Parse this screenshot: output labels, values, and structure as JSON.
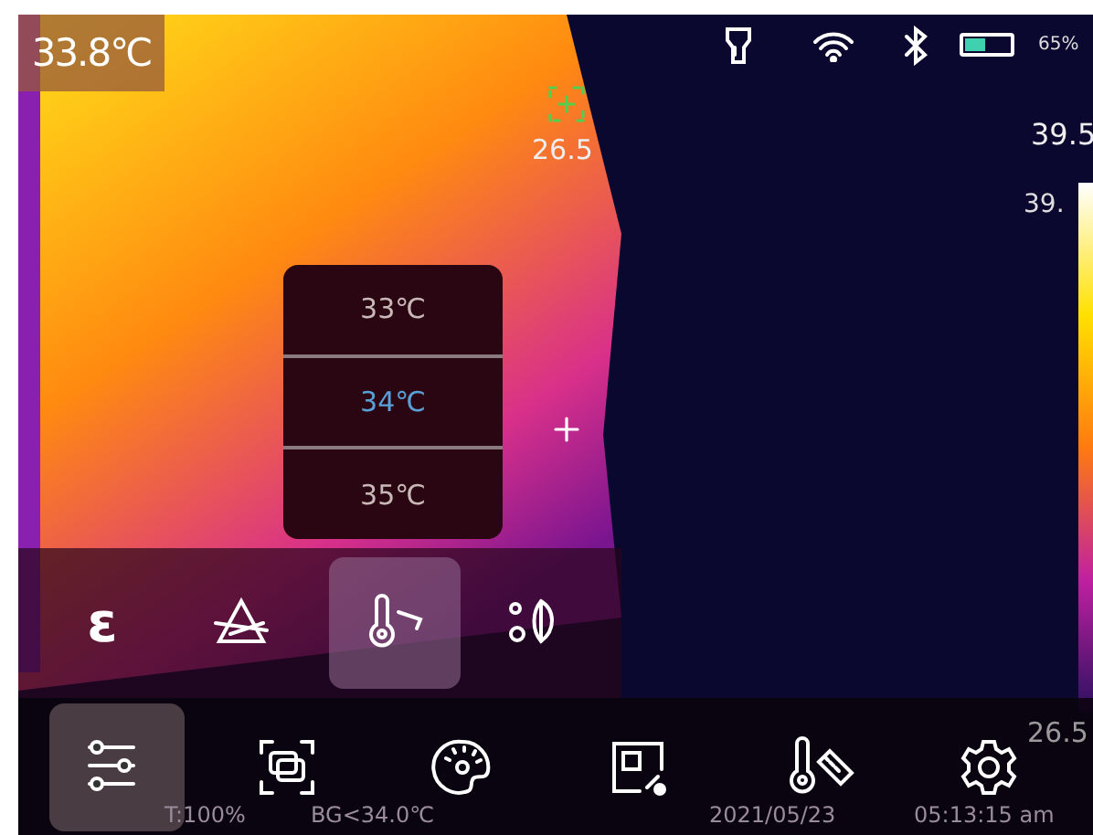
{
  "screen": {
    "spot_temperature": "33.8℃",
    "target_reading": "26.5",
    "status_bar": {
      "battery_percent": "65%"
    },
    "color_scale": {
      "max_label": "39.5",
      "value_label": "39.",
      "min_label": "26.5"
    },
    "temperature_picker": [
      {
        "label": "33℃",
        "selected": false
      },
      {
        "label": "34℃",
        "selected": true
      },
      {
        "label": "35℃",
        "selected": false
      }
    ],
    "submenu": [
      {
        "kind": "emissivity",
        "label": "ε",
        "selected": false
      },
      {
        "kind": "prism",
        "selected": false
      },
      {
        "kind": "thermometer",
        "selected": true
      },
      {
        "kind": "leaf",
        "selected": false
      }
    ],
    "toolbar": [
      {
        "kind": "sliders",
        "selected": true
      },
      {
        "kind": "overlay",
        "selected": false
      },
      {
        "kind": "palette",
        "selected": false
      },
      {
        "kind": "image-edit",
        "selected": false
      },
      {
        "kind": "thermometer-ruler",
        "selected": false
      },
      {
        "kind": "settings",
        "selected": false
      }
    ],
    "info_bar": [
      "T:100%",
      "BG<34.0℃",
      "2021/05/23",
      "05:13:15 am"
    ]
  }
}
